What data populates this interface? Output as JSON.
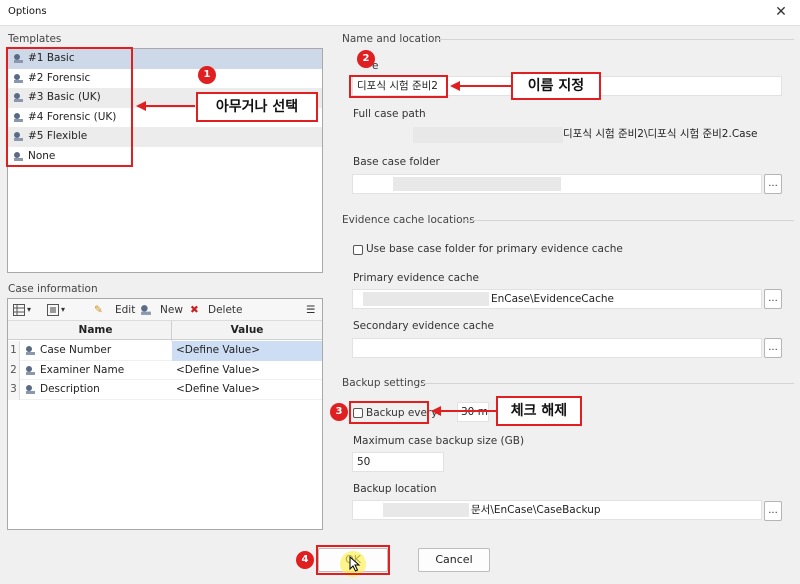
{
  "window": {
    "title": "Options",
    "close_glyph": "✕"
  },
  "templates": {
    "label": "Templates",
    "items": [
      {
        "label": "#1 Basic"
      },
      {
        "label": "#2 Forensic"
      },
      {
        "label": "#3 Basic (UK)"
      },
      {
        "label": "#4 Forensic (UK)"
      },
      {
        "label": "#5 Flexible"
      },
      {
        "label": "None"
      }
    ]
  },
  "case_info": {
    "label": "Case information",
    "toolbar": {
      "edit": "Edit",
      "new": "New",
      "delete": "Delete",
      "menu_glyph": "☰",
      "delete_glyph": "✖",
      "edit_glyph": "✎"
    },
    "columns": [
      "Name",
      "Value"
    ],
    "rows": [
      {
        "num": "1",
        "name": "Case Number",
        "value": "<Define Value>"
      },
      {
        "num": "2",
        "name": "Examiner Name",
        "value": "<Define Value>"
      },
      {
        "num": "3",
        "name": "Description",
        "value": "<Define Value>"
      }
    ]
  },
  "name_location": {
    "label": "Name and location",
    "name_label": "e",
    "name_value": "디포식 시험 준비2",
    "full_path_label": "Full case path",
    "full_path_value": "디포식 시험 준비2\\디포식 시험 준비2.Case",
    "base_folder_label": "Base case folder"
  },
  "evidence_cache": {
    "label": "Evidence cache locations",
    "use_base_label": "Use base case folder for primary evidence cache",
    "primary_label": "Primary evidence cache",
    "primary_value": "EnCase\\EvidenceCache",
    "secondary_label": "Secondary evidence cache"
  },
  "backup": {
    "label": "Backup settings",
    "backup_every_label": "Backup every",
    "backup_every_value": "30 min",
    "max_size_label": "Maximum case backup size (GB)",
    "max_size_value": "50",
    "location_label": "Backup location",
    "location_value": "문서\\EnCase\\CaseBackup"
  },
  "browse_label": "...",
  "buttons": {
    "ok": "OK",
    "cancel": "Cancel"
  },
  "annotations": {
    "badge1": "1",
    "badge2": "2",
    "badge3": "3",
    "badge4": "4",
    "callout1": "아무거나 선택",
    "callout2": "이름 지정",
    "callout3": "체크 해제"
  },
  "colors": {
    "accent_red": "#e02020",
    "selection": "#cdd8e8"
  }
}
